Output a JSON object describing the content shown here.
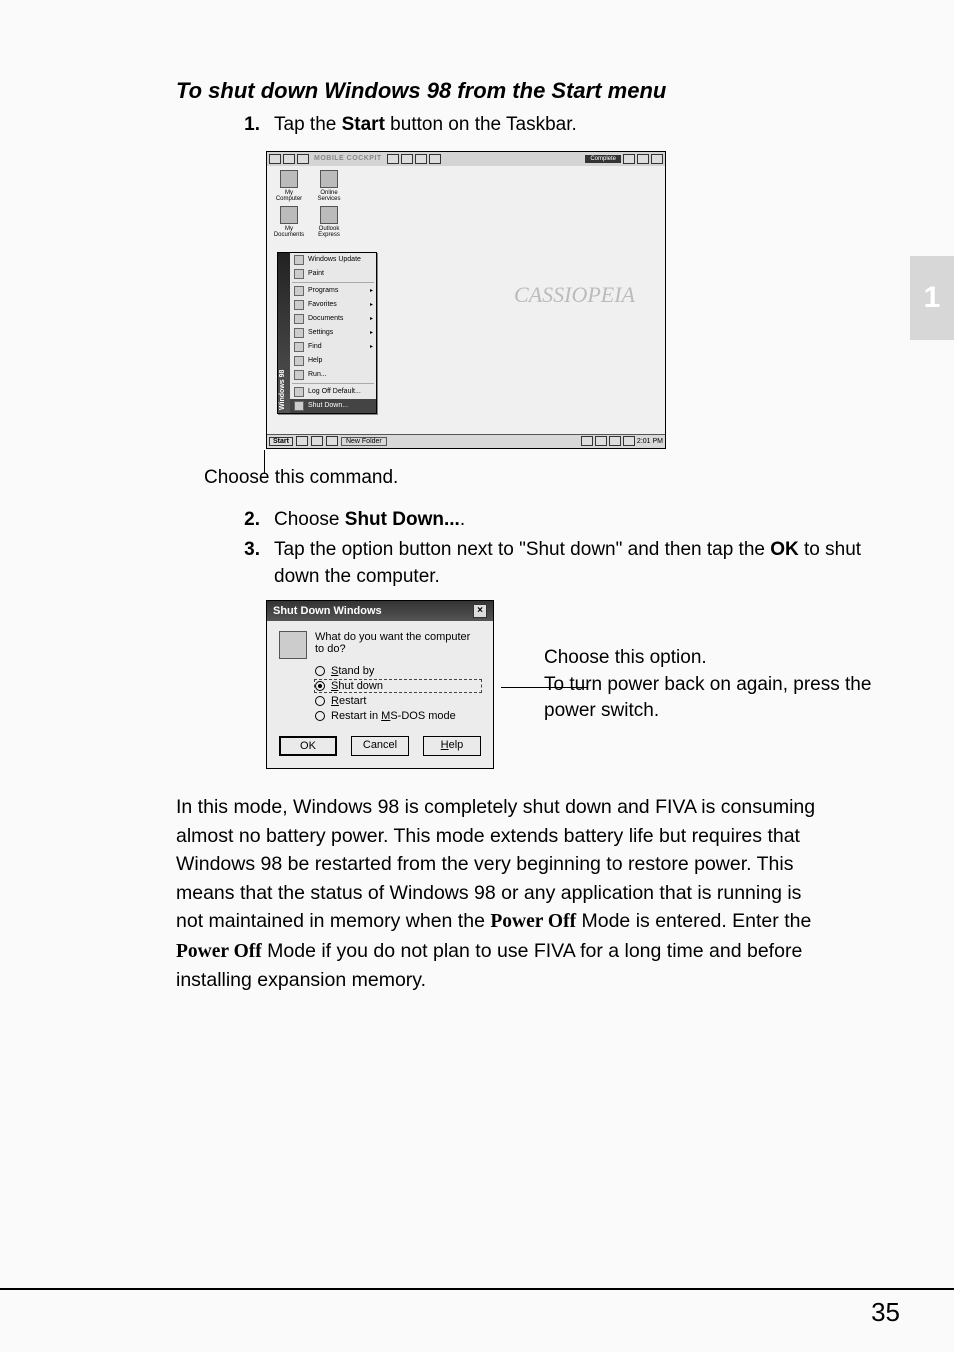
{
  "heading": "To shut down Windows 98 from the Start menu",
  "steps": {
    "step1_num": "1.",
    "step1_pre": "Tap the ",
    "step1_b": "Start",
    "step1_post": " button on the Taskbar.",
    "step2_num": "2.",
    "step2_pre": "Choose ",
    "step2_b": "Shut Down...",
    "step2_post": ".",
    "step3_num": "3.",
    "step3_pre": "Tap the option button next to \"Shut down\" and then tap the ",
    "step3_b": "OK",
    "step3_post": " to shut down the computer."
  },
  "fig1": {
    "toolbar_label": "MOBILE COCKPIT",
    "toolbar_complete": "Complete",
    "brand": "CASSIOPEIA",
    "icons": {
      "my_computer": "My\nComputer",
      "online_services": "Online\nServices",
      "my_documents": "My\nDocuments",
      "outlook_express": "Outlook\nExpress"
    },
    "start_band": "Windows 98",
    "menu": {
      "windows_update": "Windows Update",
      "paint": "Paint",
      "programs": "Programs",
      "favorites": "Favorites",
      "documents": "Documents",
      "settings": "Settings",
      "find": "Find",
      "help": "Help",
      "run": "Run...",
      "logoff": "Log Off Default...",
      "shutdown": "Shut Down..."
    },
    "taskbar": {
      "start": "Start",
      "task": "New Folder",
      "clock": "2:01 PM"
    }
  },
  "caption1": "Choose this command.",
  "dialog": {
    "title": "Shut Down Windows",
    "prompt": "What do you want the computer to do?",
    "opt_standby_u": "S",
    "opt_standby_t": "tand by",
    "opt_shutdown_u": "S",
    "opt_shutdown_t": "hut down",
    "opt_restart_u": "R",
    "opt_restart_t": "estart",
    "opt_msdos_pre": "Restart in ",
    "opt_msdos_u": "M",
    "opt_msdos_post": "S-DOS mode",
    "ok": "OK",
    "cancel": "Cancel",
    "help_u": "H",
    "help_t": "elp"
  },
  "annotation2_line1": "Choose this option.",
  "annotation2_line2": "To turn power back on again, press the power switch.",
  "para_pre": "In this mode, Windows 98 is completely shut down and FIVA is consuming almost no battery power. This mode extends battery life but requires that Windows 98 be restarted from the very beginning to restore power. This means that the status of Windows 98 or any application that is running is not maintained in memory when the ",
  "para_b1": "Power Off",
  "para_mid": " Mode is entered. Enter the ",
  "para_b2": "Power Off",
  "para_post": " Mode if you do not plan to use FIVA for a long time and before installing expansion memory.",
  "side_tab": "1",
  "page_number": "35"
}
